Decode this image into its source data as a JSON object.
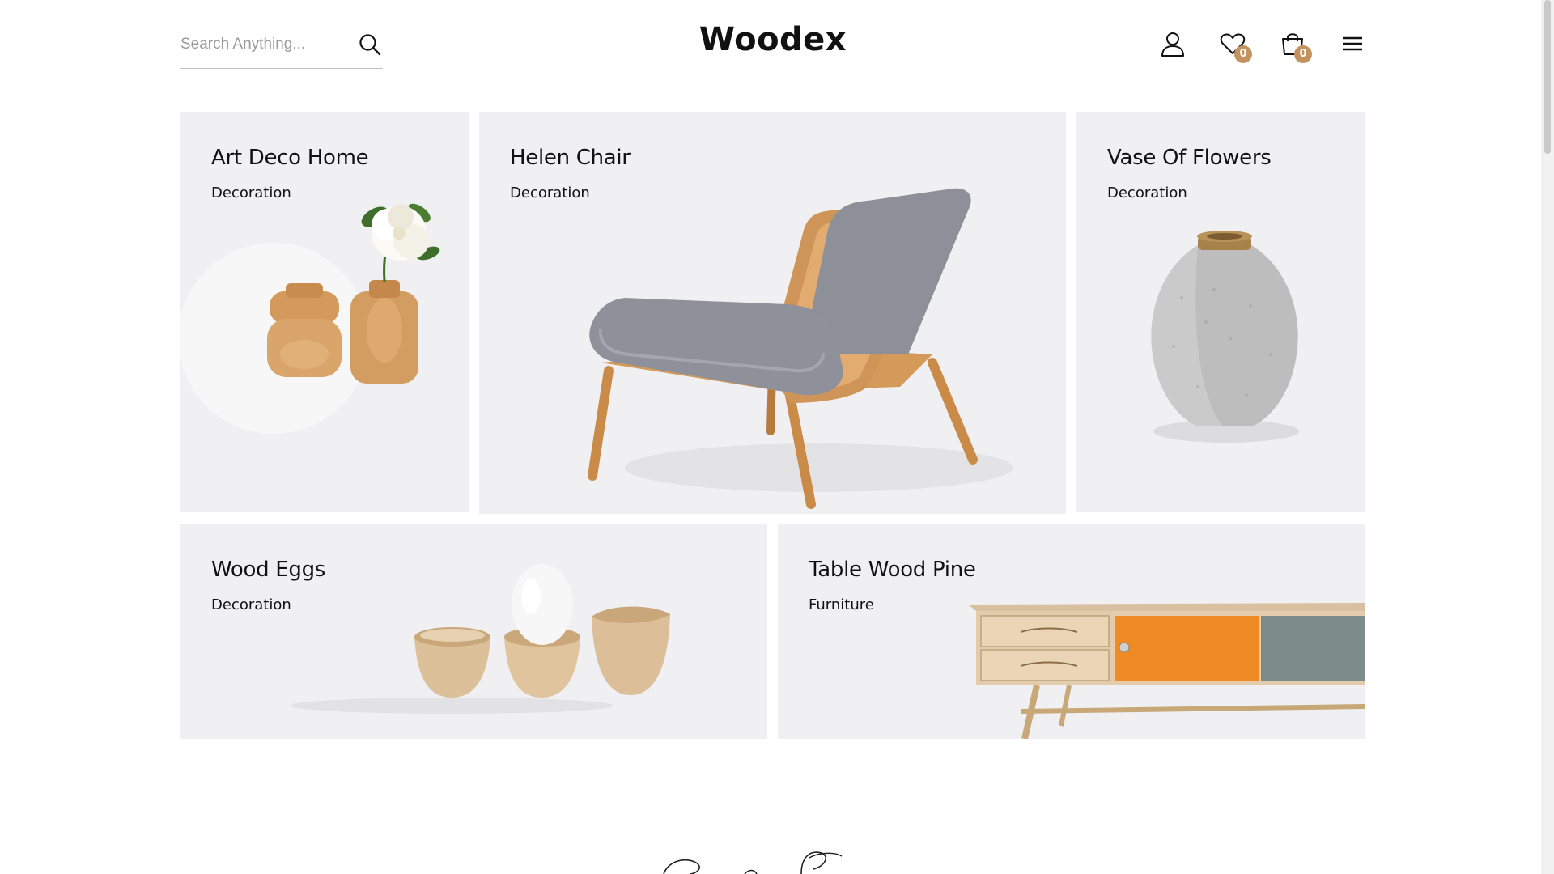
{
  "header": {
    "search_placeholder": "Search Anything...",
    "logo": "Woodex",
    "wishlist_count": "0",
    "cart_count": "0"
  },
  "icons": {
    "search": "search-icon",
    "account": "user-icon",
    "wishlist": "heart-icon",
    "cart": "shopping-bag-icon",
    "menu": "hamburger-menu-icon"
  },
  "colors": {
    "badge": "#c4925f",
    "card_bg": "#f0f0f2",
    "wood": "#d9a56b",
    "cushion": "#8a8d96",
    "drawer_orange": "#f08a24",
    "drawer_grey": "#7d8b8b"
  },
  "products": [
    {
      "title": "Art Deco Home",
      "category": "Decoration"
    },
    {
      "title": "Helen Chair",
      "category": "Decoration"
    },
    {
      "title": "Vase Of Flowers",
      "category": "Decoration"
    },
    {
      "title": "Wood Eggs",
      "category": "Decoration"
    },
    {
      "title": "Table Wood Pine",
      "category": "Furniture"
    }
  ]
}
